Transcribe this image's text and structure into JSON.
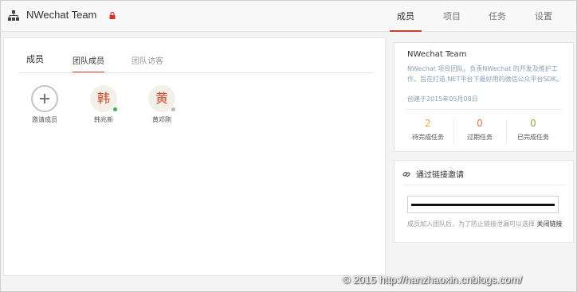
{
  "header": {
    "team_name": "NWechat Team",
    "nav": [
      "成员",
      "项目",
      "任务",
      "设置"
    ],
    "active_nav": "成员"
  },
  "members_panel": {
    "title": "成员",
    "tabs": [
      "团队成员",
      "团队访客"
    ],
    "active_tab": "团队成员",
    "invite_label": "邀请成员",
    "members": [
      {
        "avatar_char": "韩",
        "name": "韩兆新",
        "status": "online",
        "status_color": "#3cb34a"
      },
      {
        "avatar_char": "黄",
        "name": "黄邓刚",
        "status": "offline",
        "status_color": "#b8b8b8"
      }
    ]
  },
  "project_info": {
    "title": "NWechat Team",
    "description": "NWechat 项目团队。负责NWechat 的开发及维护工作。旨在打造.NET平台下最好用的微信公众平台SDK。",
    "created": "创建于2015年05月08日",
    "stats": [
      {
        "value": "2",
        "label": "待完成任务",
        "color": "#e8a44a"
      },
      {
        "value": "0",
        "label": "过期任务",
        "color": "#e8734a"
      },
      {
        "value": "0",
        "label": "已完成任务",
        "color": "#8ab04a"
      }
    ]
  },
  "invite_link": {
    "title": "通过链接邀请",
    "note": "成员加入团队后，为了防止链接泄漏可以选择",
    "close_link": "关闭链接"
  },
  "watermark": "© 2015 http://hanzhaoxin.cnblogs.com/",
  "colors": {
    "accent": "#c8412f",
    "lock": "#d0312d"
  }
}
